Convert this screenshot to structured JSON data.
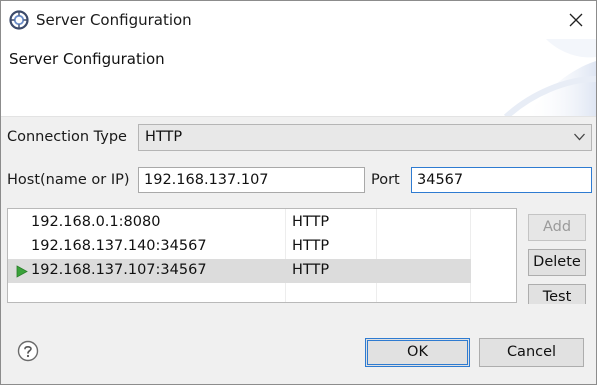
{
  "window": {
    "title": "Server Configuration",
    "icon": "eclipse-app-icon",
    "close_icon": "close-icon"
  },
  "banner": {
    "title": "Server Configuration"
  },
  "form": {
    "connection_type_label": "Connection Type",
    "connection_type_value": "HTTP",
    "host_label": "Host(name or IP)",
    "host_value": "192.168.137.107",
    "port_label": "Port",
    "port_value": "34567"
  },
  "servers": [
    {
      "host": "192.168.0.1:8080",
      "type": "HTTP",
      "active": false,
      "selected": false
    },
    {
      "host": "192.168.137.140:34567",
      "type": "HTTP",
      "active": false,
      "selected": false
    },
    {
      "host": "192.168.137.107:34567",
      "type": "HTTP",
      "active": true,
      "selected": true
    }
  ],
  "side_buttons": {
    "add": "Add",
    "delete": "Delete",
    "test": "Test"
  },
  "footer": {
    "help_icon": "help-icon",
    "ok": "OK",
    "cancel": "Cancel"
  },
  "colors": {
    "selected_row": "#dcdcdc",
    "focus_border": "#2e7bd1",
    "active_marker": "#3aa23a"
  }
}
